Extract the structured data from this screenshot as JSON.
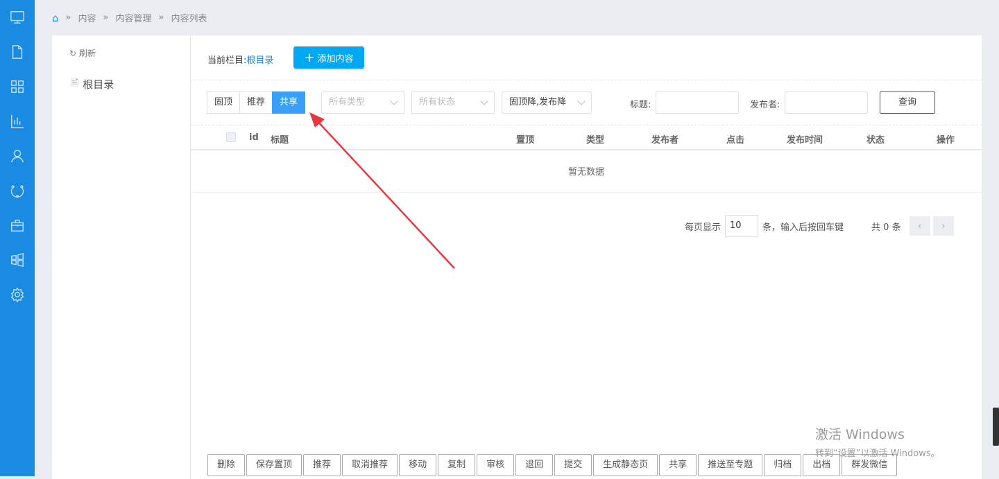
{
  "breadcrumb": [
    "内容",
    "内容管理",
    "内容列表"
  ],
  "tree": {
    "refresh": "刷新",
    "root": "根目录"
  },
  "header": {
    "current_label": "当前栏目:",
    "current_value": "根目录",
    "add_button": "添加内容"
  },
  "filters": {
    "segments": [
      "固顶",
      "推荐",
      "共享"
    ],
    "active_segment": "共享",
    "type_select": "所有类型",
    "status_select": "所有状态",
    "sort_select": "固顶降,发布降",
    "title_label": "标题:",
    "title_value": "",
    "publisher_label": "发布者:",
    "publisher_value": "",
    "query_button": "查询"
  },
  "table": {
    "columns": [
      "id",
      "标题",
      "置顶",
      "类型",
      "发布者",
      "点击",
      "发布时间",
      "状态",
      "操作"
    ],
    "empty_text": "暂无数据"
  },
  "pager": {
    "per_page_label": "每页显示",
    "per_page_value": "10",
    "hint": "条，输入后按回车键",
    "total": "共 0 条"
  },
  "actions": [
    "删除",
    "保存置顶",
    "推荐",
    "取消推荐",
    "移动",
    "复制",
    "审核",
    "退回",
    "提交",
    "生成静态页",
    "共享",
    "推送至专题",
    "归档",
    "出档",
    "群发微信"
  ],
  "watermark": {
    "line1": "激活 Windows",
    "line2": "转到“设置”以激活 Windows。"
  },
  "colors": {
    "sidebar": "#1a8ae3",
    "accent": "#00a8f3",
    "active_segment": "#3aa0f6",
    "annotation_arrow": "#e8383d"
  }
}
